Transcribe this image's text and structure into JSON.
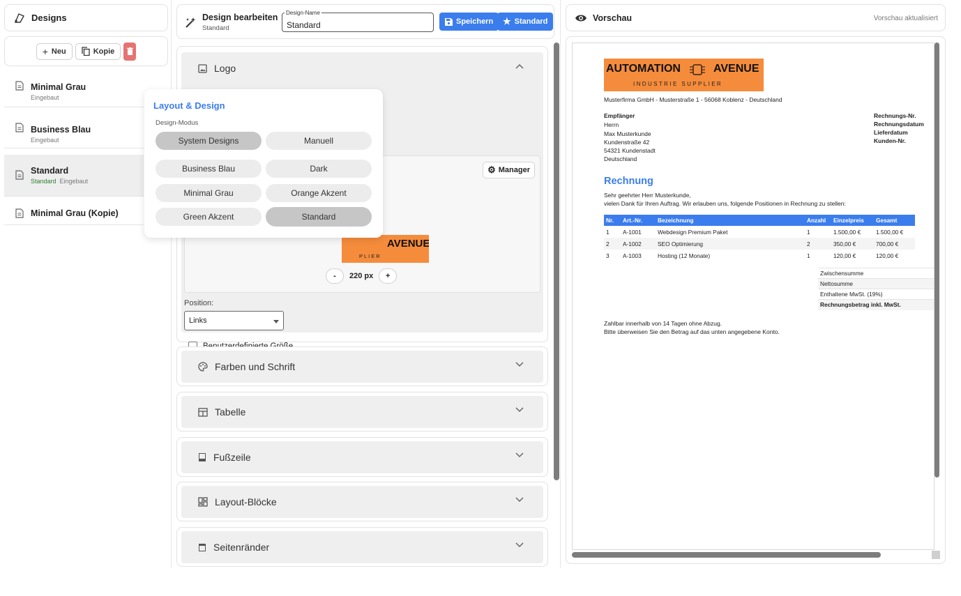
{
  "sidebar": {
    "title": "Designs",
    "new_label": "Neu",
    "copy_label": "Kopie",
    "items": [
      {
        "name": "Minimal Grau",
        "sub": "Eingebaut",
        "standard": ""
      },
      {
        "name": "Business Blau",
        "sub": "Eingebaut",
        "standard": ""
      },
      {
        "name": "Standard",
        "sub": "Eingebaut",
        "standard": "Standard"
      },
      {
        "name": "Minimal Grau (Kopie)",
        "sub": "",
        "standard": ""
      }
    ]
  },
  "editor": {
    "title": "Design bearbeiten",
    "subtitle": "Standard",
    "name_legend": "Design-Name",
    "name_value": "Standard",
    "save_label": "Speichern",
    "default_label": "Standard",
    "sections": {
      "logo": "Logo",
      "colors": "Farben und Schrift",
      "table": "Tabelle",
      "footer": "Fußzeile",
      "blocks": "Layout-Blöcke",
      "margins": "Seitenränder"
    },
    "manager_label": "Manager",
    "logo_width": "220 px",
    "minus": "-",
    "plus": "+",
    "logo_preview_text": "AVENUE",
    "logo_preview_sub": "PLIER",
    "position_label": "Position:",
    "position_value": "Links",
    "custom_size_label": "Benutzerdefinierte Größe"
  },
  "popover": {
    "title": "Layout & Design",
    "mode_label": "Design-Modus",
    "modes": [
      "System Designs",
      "Manuell"
    ],
    "designs": [
      "Business Blau",
      "Dark",
      "Minimal Grau",
      "Orange Akzent",
      "Green Akzent",
      "Standard"
    ]
  },
  "preview": {
    "title": "Vorschau",
    "status": "Vorschau aktualisiert",
    "invoice": {
      "logo_main_left": "AUTOMATION",
      "logo_main_right": "AVENUE",
      "logo_sub": "INDUSTRIE SUPPLIER",
      "sender": "Musterfirma GmbH - Musterstraße 1 - 56068 Koblenz - Deutschland",
      "recipient_label": "Empfänger",
      "recipient": [
        "Herrn",
        "Max Musterkunde",
        "Kundenstraße 42",
        "54321 Kundenstadt",
        "Deutschland"
      ],
      "meta": [
        "Rechnungs-Nr.",
        "Rechnungsdatum",
        "Lieferdatum",
        "Kunden-Nr."
      ],
      "heading": "Rechnung",
      "greeting": "Sehr geehrter Herr Musterkunde,",
      "intro": "vielen Dank für Ihren Auftrag. Wir erlauben uns, folgende Positionen in Rechnung zu stellen:",
      "columns": [
        "Nr.",
        "Art.-Nr.",
        "Bezeichnung",
        "Anzahl",
        "Einzelpreis",
        "Gesamt"
      ],
      "rows": [
        [
          "1",
          "A-1001",
          "Webdesign Premium Paket",
          "1",
          "1.500,00 €",
          "1.500,00 €"
        ],
        [
          "2",
          "A-1002",
          "SEO Optimierung",
          "2",
          "350,00 €",
          "700,00 €"
        ],
        [
          "3",
          "A-1003",
          "Hosting (12 Monate)",
          "1",
          "120,00 €",
          "120,00 €"
        ]
      ],
      "totals": [
        "Zwischensumme",
        "Nettosumme",
        "Enthaltene MwSt. (19%)",
        "Rechnungsbetrag inkl. MwSt."
      ],
      "payment_1": "Zahlbar innerhalb von 14 Tagen ohne Abzug.",
      "payment_2": "Bitte überweisen Sie den Betrag auf das unten angegebene Konto."
    }
  },
  "colors": {
    "accent": "#3b7ded",
    "logo_orange": "#f58c3c",
    "danger": "#e57373",
    "standard_green": "#2e7d32"
  }
}
